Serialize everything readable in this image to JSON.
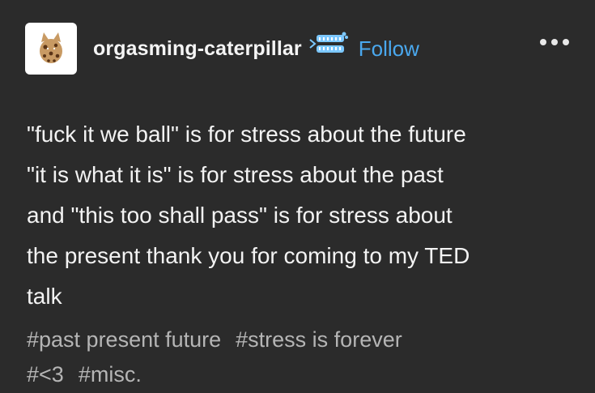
{
  "post": {
    "username": "orgasming-caterpillar",
    "follow_label": "Follow",
    "avatar_icon": "cookie-cat-avatar",
    "badge_icon": "blue-fish-skeleton-badge",
    "more_icon": "ellipsis-icon",
    "body_lines": [
      "\"fuck it we ball\" is for stress about the future",
      "\"it is what it is\" is for stress about the past",
      "and \"this too shall pass\" is for stress about",
      "the present thank you for coming to my TED",
      "talk"
    ],
    "tags": [
      "#past present future",
      "#stress is forever",
      "#<3",
      "#misc."
    ]
  },
  "colors": {
    "background": "#2b2b2b",
    "text": "#f3f3f3",
    "follow": "#4aa8ee",
    "tags": "#b5b5b5"
  }
}
